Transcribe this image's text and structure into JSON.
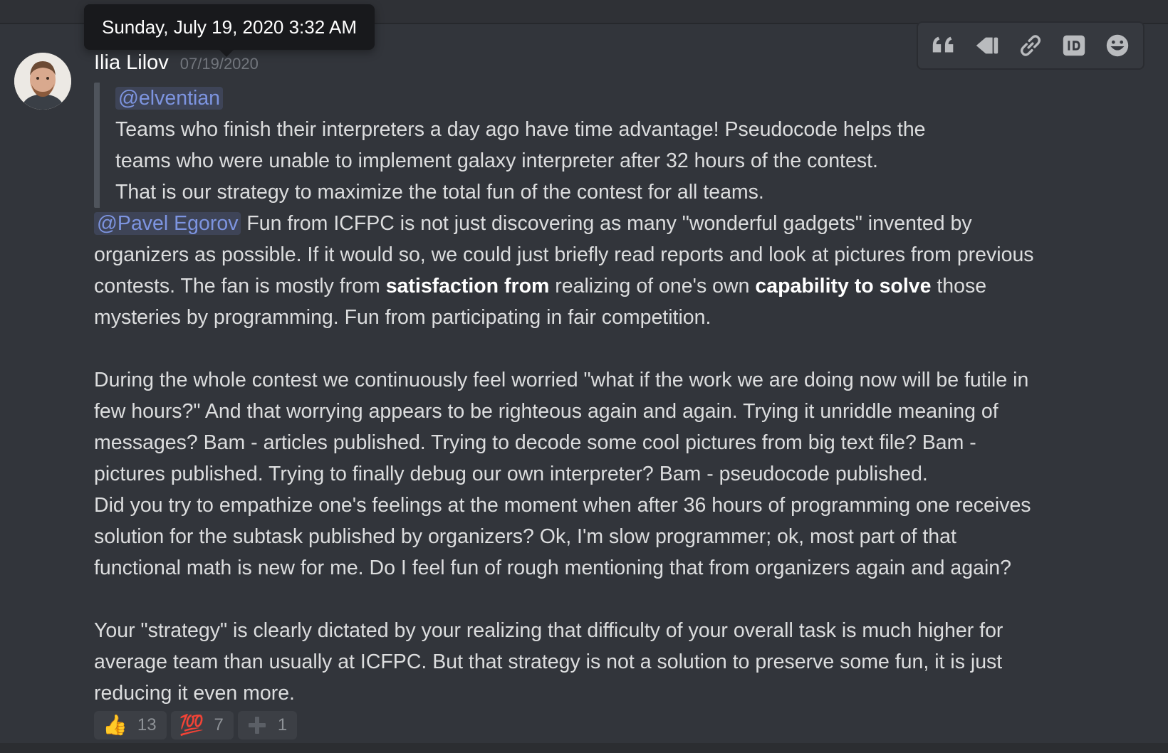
{
  "tooltip": {
    "text": "Sunday, July 19, 2020 3:32 AM"
  },
  "toolbar": {
    "items": [
      {
        "icon": "quote-icon",
        "label": "Quote"
      },
      {
        "icon": "megaphone-icon",
        "label": "Announce"
      },
      {
        "icon": "link-icon",
        "label": "Copy link"
      },
      {
        "icon": "id-icon",
        "label": "Copy ID"
      },
      {
        "icon": "add-reaction-icon",
        "label": "Add reaction"
      }
    ]
  },
  "message": {
    "author": "Ilia Lilov",
    "date": "07/19/2020",
    "quote": {
      "mention": "@elventian",
      "lines": [
        "Teams who finish their interpreters a day ago have time advantage! Pseudocode helps the",
        "teams who were unable to implement galaxy interpreter after 32 hours of the contest.",
        "That is our strategy to maximize the total fun of the contest for all teams."
      ]
    },
    "paragraph1": {
      "mention": "@Pavel Egorov",
      "line1_rest": " Fun from ICFPC is not just discovering as many \"wonderful gadgets\" invented by",
      "line2": "organizers as possible. If it would so, we could just briefly read reports and look at pictures from previous",
      "line3_a": "contests. The fan is mostly from ",
      "line3_b1": "satisfaction from",
      "line3_c": " realizing of one's own ",
      "line3_b2": "capability to solve",
      "line3_d": " those",
      "line4": "mysteries by programming. Fun from participating in fair competition."
    },
    "paragraph2": [
      "During the whole contest we continuously feel worried \"what if the work we are doing now will be futile in",
      "few hours?\" And that worrying appears to be righteous again and again. Trying it unriddle meaning of",
      "messages? Bam - articles published. Trying to decode some cool pictures from big text file? Bam -",
      "pictures published. Trying to finally debug our own interpreter? Bam - pseudocode published.",
      "Did you try to empathize one's feelings at the moment when after 36 hours of programming one receives",
      "solution for the subtask published by organizers? Ok, I'm slow programmer; ok, most part of that",
      "functional math is new for me. Do I feel fun of rough mentioning that from organizers again and again?"
    ],
    "paragraph3": [
      "Your \"strategy\" is clearly dictated by your realizing that difficulty of your overall task is much higher for",
      "average team than usually at ICFPC. But that strategy is not a solution to preserve some fun, it is just",
      "reducing it even more."
    ]
  },
  "reactions": [
    {
      "emoji": "👍",
      "name": "thumbs-up",
      "count": "13"
    },
    {
      "emoji": "💯",
      "name": "hundred-points",
      "count": "7"
    },
    {
      "emoji": "+",
      "name": "plus",
      "count": "1"
    }
  ]
}
